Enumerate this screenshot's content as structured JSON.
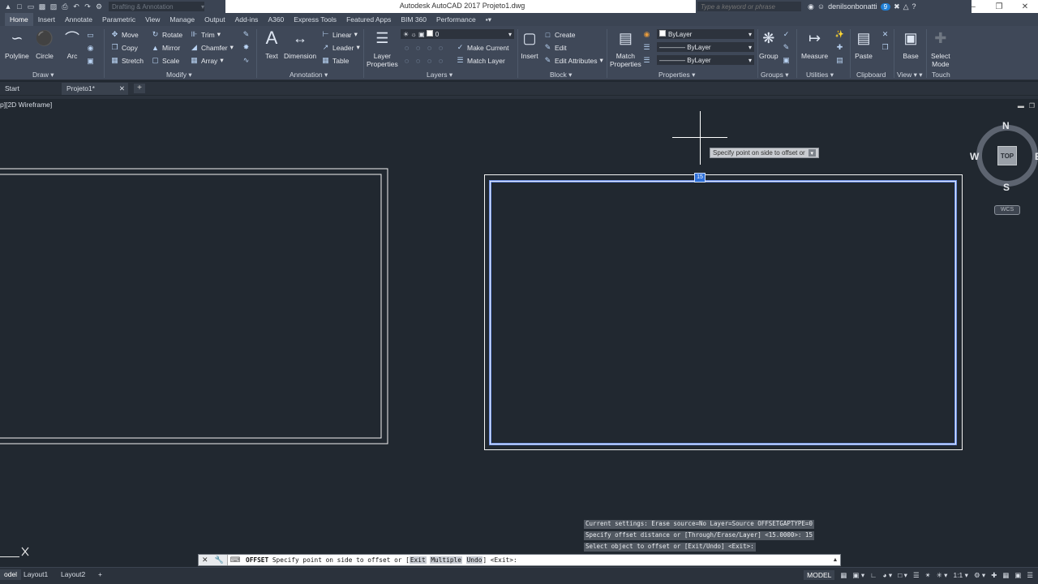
{
  "titlebar": {
    "workspace": "Drafting & Annotation",
    "title": "Autodesk AutoCAD 2017    Projeto1.dwg",
    "search_placeholder": "Type a keyword or phrase",
    "user": "denilsonbonatti",
    "notification_count": "9"
  },
  "tabs": [
    "Home",
    "Insert",
    "Annotate",
    "Parametric",
    "View",
    "Manage",
    "Output",
    "Add-ins",
    "A360",
    "Express Tools",
    "Featured Apps",
    "BIM 360",
    "Performance"
  ],
  "ribbon": {
    "draw": {
      "polyline": "Polyline",
      "circle": "Circle",
      "arc": "Arc",
      "title": "Draw"
    },
    "modify": {
      "move": "Move",
      "rotate": "Rotate",
      "trim": "Trim",
      "copy": "Copy",
      "mirror": "Mirror",
      "chamfer": "Chamfer",
      "stretch": "Stretch",
      "scale": "Scale",
      "array": "Array",
      "title": "Modify"
    },
    "annotation": {
      "text": "Text",
      "dimension": "Dimension",
      "linear": "Linear",
      "leader": "Leader",
      "table": "Table",
      "title": "Annotation"
    },
    "layers": {
      "layer_properties_1": "Layer",
      "layer_properties_2": "Properties",
      "current_layer": "0",
      "make_current": "Make Current",
      "match_layer": "Match Layer",
      "title": "Layers"
    },
    "block": {
      "insert": "Insert",
      "create": "Create",
      "edit": "Edit",
      "edit_attributes": "Edit Attributes",
      "title": "Block"
    },
    "properties": {
      "match_1": "Match",
      "match_2": "Properties",
      "color": "ByLayer",
      "linetype": "ByLayer",
      "lineweight": "ByLayer",
      "title": "Properties"
    },
    "groups": {
      "group": "Group",
      "title": "Groups"
    },
    "utilities": {
      "measure": "Measure",
      "title": "Utilities"
    },
    "clipboard": {
      "paste": "Paste",
      "title": "Clipboard"
    },
    "view": {
      "base": "Base",
      "title": "View"
    },
    "touch": {
      "select_1": "Select",
      "select_2": "Mode",
      "title": "Touch"
    }
  },
  "filetabs": {
    "start": "Start",
    "file": "Projeto1*"
  },
  "viewport": {
    "label": "p][2D Wireframe]"
  },
  "viewcube": {
    "n": "N",
    "s": "S",
    "w": "W",
    "e": "E",
    "top": "TOP",
    "wcs": "WCS"
  },
  "tooltip": {
    "text": "Specify point on side to offset or"
  },
  "grip_value": "15",
  "command_history": [
    "Current settings: Erase source=No  Layer=Source  OFFSETGAPTYPE=0",
    "Specify offset distance or [Through/Erase/Layer] <15.0000>: 15",
    "Select object to offset or [Exit/Undo] <Exit>:"
  ],
  "command_bar": {
    "command": "OFFSET",
    "prompt": " Specify point on side to offset or [",
    "opt1": "Exit",
    "opt2": "Multiple",
    "opt3": "Undo",
    "tail": "] <Exit>:"
  },
  "statusbar": {
    "model_tab": "odel",
    "layout1": "Layout1",
    "layout2": "Layout2",
    "model_button": "MODEL",
    "scale": "1:1"
  }
}
